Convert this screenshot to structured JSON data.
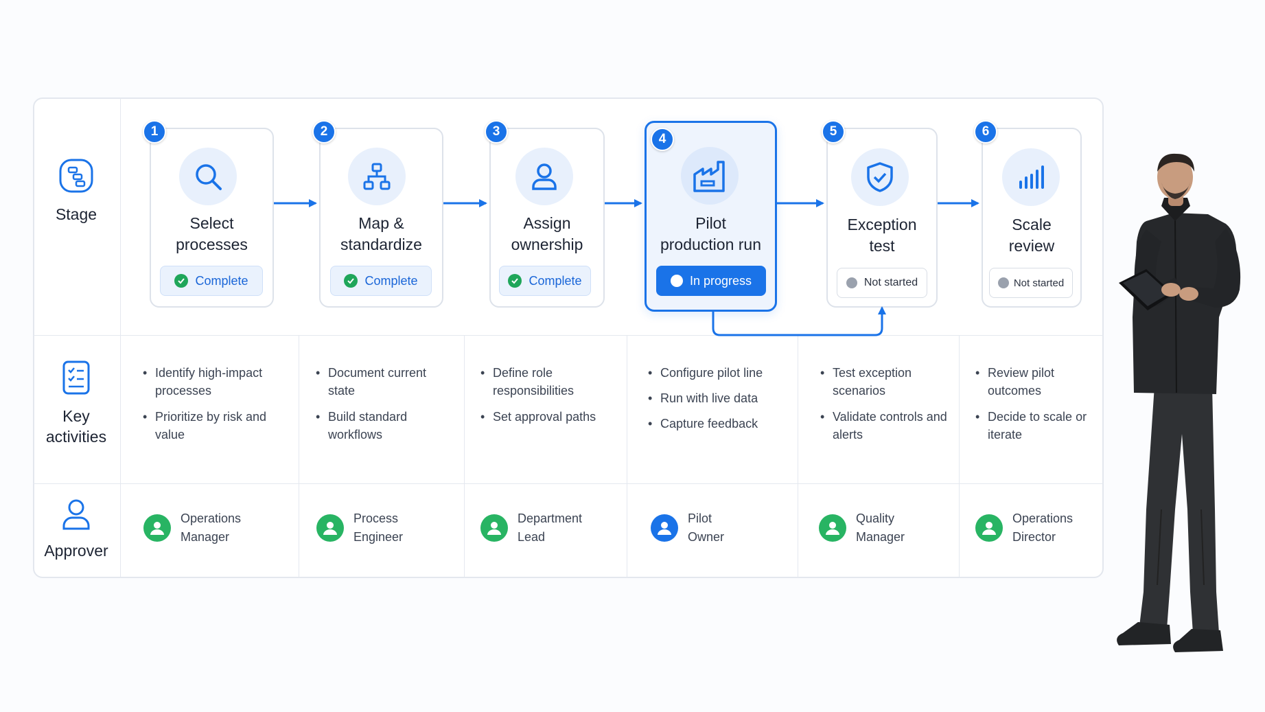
{
  "row_labels": {
    "stage": "Stage",
    "activities": "Key activities",
    "approver": "Approver"
  },
  "stages": [
    {
      "num": "1",
      "title_l1": "Select",
      "title_l2": "processes",
      "status": "Complete",
      "icon": "search-icon"
    },
    {
      "num": "2",
      "title_l1": "Map &",
      "title_l2": "standardize",
      "status": "Complete",
      "icon": "hierarchy-icon"
    },
    {
      "num": "3",
      "title_l1": "Assign",
      "title_l2": "ownership",
      "status": "Complete",
      "icon": "user-icon"
    },
    {
      "num": "4",
      "title_l1": "Pilot",
      "title_l2": "production run",
      "status": "In progress",
      "icon": "factory-icon"
    },
    {
      "num": "5",
      "title_l1": "Exception",
      "title_l2": "test",
      "status": "Not started",
      "icon": "shield-check-icon"
    },
    {
      "num": "6",
      "title_l1": "Scale",
      "title_l2": "review",
      "status": "Not started",
      "icon": "bar-chart-icon"
    }
  ],
  "activities": [
    [
      "Identify high-impact processes",
      "Prioritize by risk and value"
    ],
    [
      "Document current state",
      "Build standard workflows"
    ],
    [
      "Define role responsibilities",
      "Set approval paths"
    ],
    [
      "Configure pilot line",
      "Run with live data",
      "Capture feedback"
    ],
    [
      "Test exception scenarios",
      "Validate controls and alerts"
    ],
    [
      "Review pilot outcomes",
      "Decide to scale or iterate"
    ]
  ],
  "approvers": [
    {
      "l1": "Operations",
      "l2": "Manager"
    },
    {
      "l1": "Process",
      "l2": "Engineer"
    },
    {
      "l1": "Department",
      "l2": "Lead"
    },
    {
      "l1": "Pilot",
      "l2": "Owner"
    },
    {
      "l1": "Quality",
      "l2": "Manager"
    },
    {
      "l1": "Operations",
      "l2": "Director"
    }
  ],
  "colors": {
    "accent": "#1a73e8",
    "complete": "#1fa65a",
    "approver_green": "#28b463",
    "not_started": "#9aa1ad"
  }
}
